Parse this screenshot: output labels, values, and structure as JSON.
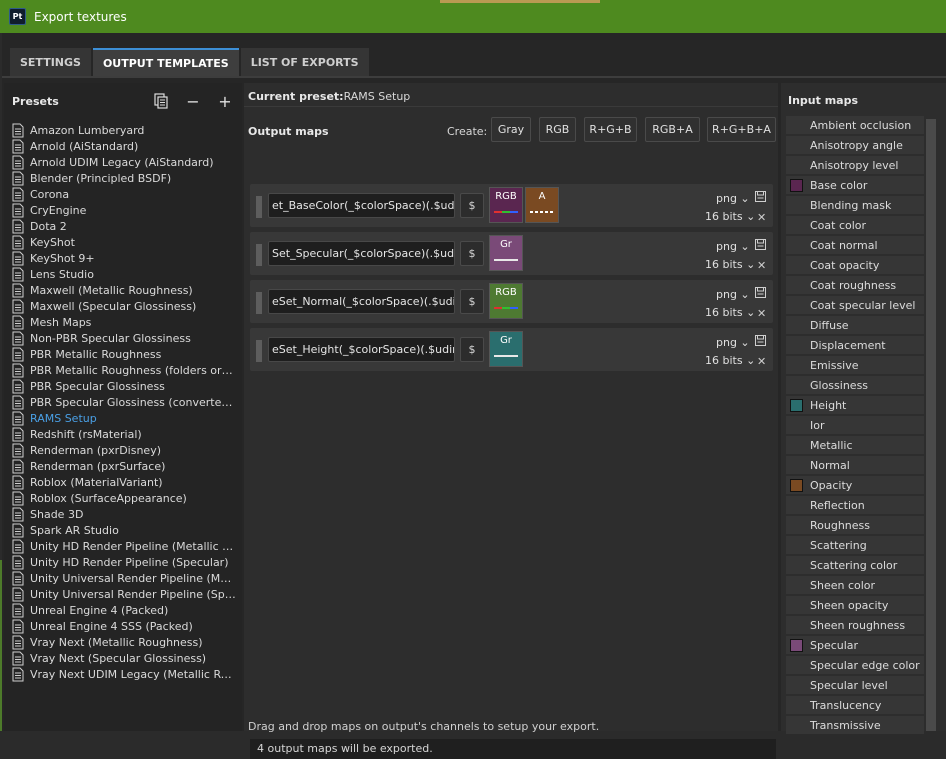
{
  "window": {
    "title": "Export textures",
    "app_icon": "Pt"
  },
  "tabs": [
    {
      "label": "SETTINGS",
      "active": false
    },
    {
      "label": "OUTPUT TEMPLATES",
      "active": true
    },
    {
      "label": "LIST OF EXPORTS",
      "active": false
    }
  ],
  "presets": {
    "title": "Presets",
    "selected": "RAMS Setup",
    "items": [
      "Amazon Lumberyard",
      "Arnold (AiStandard)",
      "Arnold UDIM Legacy (AiStandard)",
      "Blender (Principled BSDF)",
      "Corona",
      "CryEngine",
      "Dota 2",
      "KeyShot",
      "KeyShot 9+",
      "Lens Studio",
      "Maxwell (Metallic Roughness)",
      "Maxwell (Specular Glossiness)",
      "Mesh Maps",
      "Non-PBR Specular Glossiness",
      "PBR Metallic Roughness",
      "PBR Metallic Roughness (folders or P...",
      "PBR Specular Glossiness",
      "PBR Specular Glossiness (converted fr...",
      "RAMS Setup",
      "Redshift (rsMaterial)",
      "Renderman (pxrDisney)",
      "Renderman (pxrSurface)",
      "Roblox (MaterialVariant)",
      "Roblox (SurfaceAppearance)",
      "Shade 3D",
      "Spark AR Studio",
      "Unity HD Render Pipeline (Metallic St...",
      "Unity HD Render Pipeline (Specular)",
      "Unity Universal Render Pipeline (Meta...",
      "Unity Universal Render Pipeline (Spec...",
      "Unreal Engine 4 (Packed)",
      "Unreal Engine 4 SSS (Packed)",
      "Vray Next (Metallic Roughness)",
      "Vray Next (Specular Glossiness)",
      "Vray Next UDIM Legacy (Metallic Rou..."
    ]
  },
  "current_preset": {
    "label": "Current preset:",
    "value": "RAMS Setup"
  },
  "output_maps": {
    "title": "Output maps",
    "create_label": "Create:",
    "create_buttons": [
      "Gray",
      "RGB",
      "R+G+B",
      "RGB+A",
      "R+G+B+A"
    ],
    "dollar": "$",
    "rows": [
      {
        "filename": "et_BaseColor(_$colorSpace)(.$udim)",
        "format": "png",
        "bits": "16 bits",
        "channels": [
          {
            "label": "RGB",
            "color": "#5a2650",
            "bar": "rgb"
          },
          {
            "label": "A",
            "color": "#7a4a22",
            "bar": "dotted"
          }
        ]
      },
      {
        "filename": "Set_Specular(_$colorSpace)(.$udim)",
        "format": "png",
        "bits": "16 bits",
        "channels": [
          {
            "label": "Gr",
            "color": "#7a4a78",
            "bar": "white"
          }
        ]
      },
      {
        "filename": "eSet_Normal(_$colorSpace)(.$udim)",
        "format": "png",
        "bits": "16 bits",
        "channels": [
          {
            "label": "RGB",
            "color": "#4e7a32",
            "bar": "rgb"
          }
        ]
      },
      {
        "filename": "eSet_Height(_$colorSpace)(.$udim)",
        "format": "png",
        "bits": "16 bits",
        "channels": [
          {
            "label": "Gr",
            "color": "#2a6e6e",
            "bar": "white"
          }
        ]
      }
    ]
  },
  "hint": "Drag and drop maps on output's channels to setup your export.",
  "status": "4 output maps will be exported.",
  "input_maps": {
    "title": "Input maps",
    "items": [
      {
        "label": "Ambient occlusion"
      },
      {
        "label": "Anisotropy angle"
      },
      {
        "label": "Anisotropy level"
      },
      {
        "label": "Base color",
        "swatch": "#5a2650"
      },
      {
        "label": "Blending mask"
      },
      {
        "label": "Coat color"
      },
      {
        "label": "Coat normal"
      },
      {
        "label": "Coat opacity"
      },
      {
        "label": "Coat roughness"
      },
      {
        "label": "Coat specular level"
      },
      {
        "label": "Diffuse"
      },
      {
        "label": "Displacement"
      },
      {
        "label": "Emissive"
      },
      {
        "label": "Glossiness"
      },
      {
        "label": "Height",
        "swatch": "#2a6e6e"
      },
      {
        "label": "Ior"
      },
      {
        "label": "Metallic"
      },
      {
        "label": "Normal"
      },
      {
        "label": "Opacity",
        "swatch": "#7a4a22"
      },
      {
        "label": "Reflection"
      },
      {
        "label": "Roughness"
      },
      {
        "label": "Scattering"
      },
      {
        "label": "Scattering color"
      },
      {
        "label": "Sheen color"
      },
      {
        "label": "Sheen opacity"
      },
      {
        "label": "Sheen roughness"
      },
      {
        "label": "Specular",
        "swatch": "#7a4a78"
      },
      {
        "label": "Specular edge color"
      },
      {
        "label": "Specular level"
      },
      {
        "label": "Translucency"
      },
      {
        "label": "Transmissive"
      }
    ]
  }
}
